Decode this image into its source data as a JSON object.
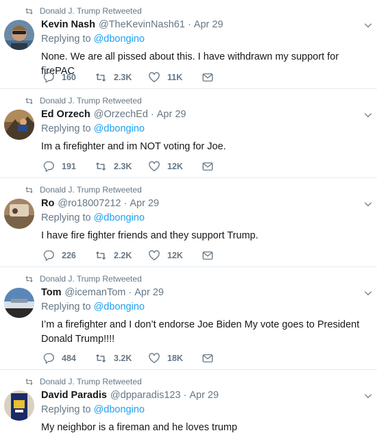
{
  "tweets": [
    {
      "retweeted_by": "Donald J. Trump Retweeted",
      "name": "Kevin Nash",
      "handle": "@TheKevinNash61",
      "time": "Apr 29",
      "replying_prefix": "Replying to",
      "replying_to": "@dbongino",
      "text": "None.  We are all pissed about this.  I have withdrawn my support for firePAC",
      "replies": "160",
      "retweets": "2.3K",
      "likes": "11K"
    },
    {
      "retweeted_by": "Donald J. Trump Retweeted",
      "name": "Ed Orzech",
      "handle": "@OrzechEd",
      "time": "Apr 29",
      "replying_prefix": "Replying to",
      "replying_to": "@dbongino",
      "text": "Im a firefighter and im NOT voting for Joe.",
      "replies": "191",
      "retweets": "2.3K",
      "likes": "12K"
    },
    {
      "retweeted_by": "Donald J. Trump Retweeted",
      "name": "Ro",
      "handle": "@ro18007212",
      "time": "Apr 29",
      "replying_prefix": "Replying to",
      "replying_to": "@dbongino",
      "text": "I have fire fighter friends and they support Trump.",
      "replies": "226",
      "retweets": "2.2K",
      "likes": "12K"
    },
    {
      "retweeted_by": "Donald J. Trump Retweeted",
      "name": "Tom",
      "handle": "@icemanTom",
      "time": "Apr 29",
      "replying_prefix": "Replying to",
      "replying_to": "@dbongino",
      "text": "I’m a firefighter and I don’t endorse Joe Biden   My vote goes to President Donald Trump!!!!",
      "replies": "484",
      "retweets": "3.2K",
      "likes": "18K"
    },
    {
      "retweeted_by": "Donald J. Trump Retweeted",
      "name": "David Paradis",
      "handle": "@dpparadis123",
      "time": "Apr 29",
      "replying_prefix": "Replying to",
      "replying_to": "@dbongino",
      "text": "My neighbor is a fireman and he loves trump"
    }
  ],
  "icons": {
    "retweet": "retweet-icon",
    "reply": "reply-icon",
    "like": "heart-icon",
    "message": "envelope-icon",
    "more": "chevron-down-icon"
  },
  "colors": {
    "text": "#14171a",
    "secondary": "#657786",
    "link": "#1da1f2",
    "divider": "#e6ecf0"
  }
}
